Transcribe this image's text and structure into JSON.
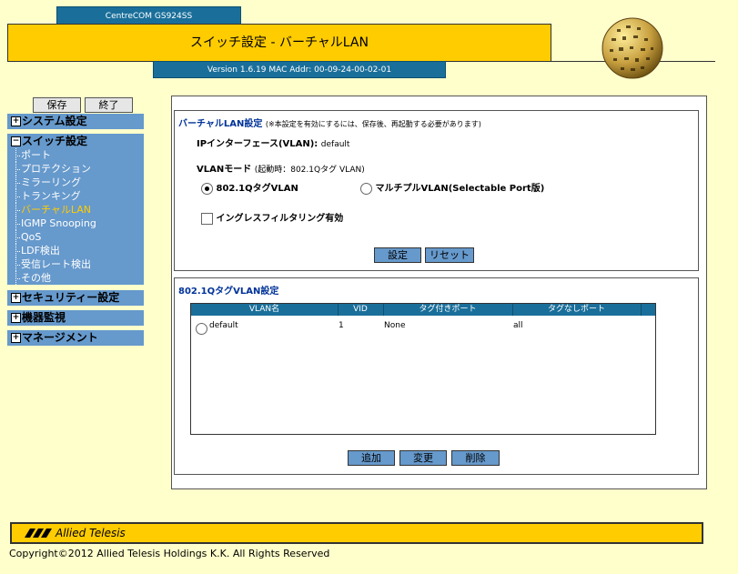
{
  "header": {
    "model": "CentreCOM GS924SS",
    "title": "スイッチ設定 - バーチャルLAN",
    "version": "Version 1.6.19 MAC Addr: 00-09-24-00-02-01"
  },
  "nav": {
    "save_label": "保存",
    "exit_label": "終了",
    "groups": [
      "システム設定",
      "スイッチ設定",
      "セキュリティー設定",
      "機器監視",
      "マネージメント"
    ],
    "switch_items": [
      "ポート",
      "プロテクション",
      "ミラーリング",
      "トランキング",
      "バーチャルLAN",
      "IGMP Snooping",
      "QoS",
      "LDF検出",
      "受信レート検出",
      "その他"
    ]
  },
  "vlan_settings": {
    "title": "バーチャルLAN設定",
    "note": "(※本設定を有効にするには、保存後、再起動する必要があります)",
    "ip_interface_label": "IPインターフェース(VLAN):",
    "ip_interface_value": "default",
    "mode_label": "VLANモード",
    "mode_boot": "(起動時：802.1Qタグ VLAN)",
    "option_tagged": "802.1QタグVLAN",
    "option_multiple": "マルチプルVLAN(Selectable Port版)",
    "ingress_filter": "イングレスフィルタリング有効",
    "set_button": "設定",
    "reset_button": "リセット"
  },
  "tagged_vlan": {
    "title": "802.1QタグVLAN設定",
    "columns": [
      "VLAN名",
      "VID",
      "タグ付きポート",
      "タグなしポート"
    ],
    "rows": [
      {
        "name": "default",
        "vid": "1",
        "tagged": "None",
        "untagged": "all"
      }
    ],
    "add_button": "追加",
    "edit_button": "変更",
    "delete_button": "削除"
  },
  "footer": {
    "logo": "Allied Telesis",
    "copyright": "Copyright©2012 Allied Telesis Holdings K.K. All Rights Reserved"
  },
  "colors": {
    "background": "#ffffcc",
    "accent_yellow": "#ffcc00",
    "nav_blue": "#6699cc",
    "header_blue": "#1a6f9a",
    "title_text": "#003399"
  }
}
